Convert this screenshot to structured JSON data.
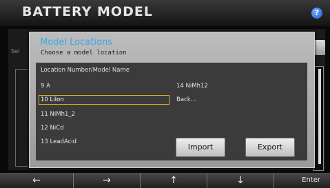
{
  "app": {
    "title": "BATTERY MODEL",
    "help_glyph": "?"
  },
  "background": {
    "select_label": "Sel"
  },
  "dialog": {
    "title": "Model Locations",
    "subtitle": "Choose a model location",
    "column_header": "Location Number/Model Name",
    "items_left": [
      "9 A",
      "10 LiIon",
      "11 NiMh1_2",
      "12 NiCd",
      "13 LeadAcid"
    ],
    "items_right": [
      "14 NiMh12",
      "Back..."
    ],
    "selected_item": "10 LiIon",
    "import_label": "Import",
    "export_label": "Export"
  },
  "softkeys": {
    "left_icon": "left-arrow-icon",
    "right_icon": "right-arrow-icon",
    "up_icon": "up-arrow-icon",
    "down_icon": "down-arrow-icon",
    "enter_label": "Enter"
  },
  "colors": {
    "dialog_title": "#3aa9e8",
    "selection_border": "#e2b422",
    "help_icon": "#2f78e6"
  }
}
